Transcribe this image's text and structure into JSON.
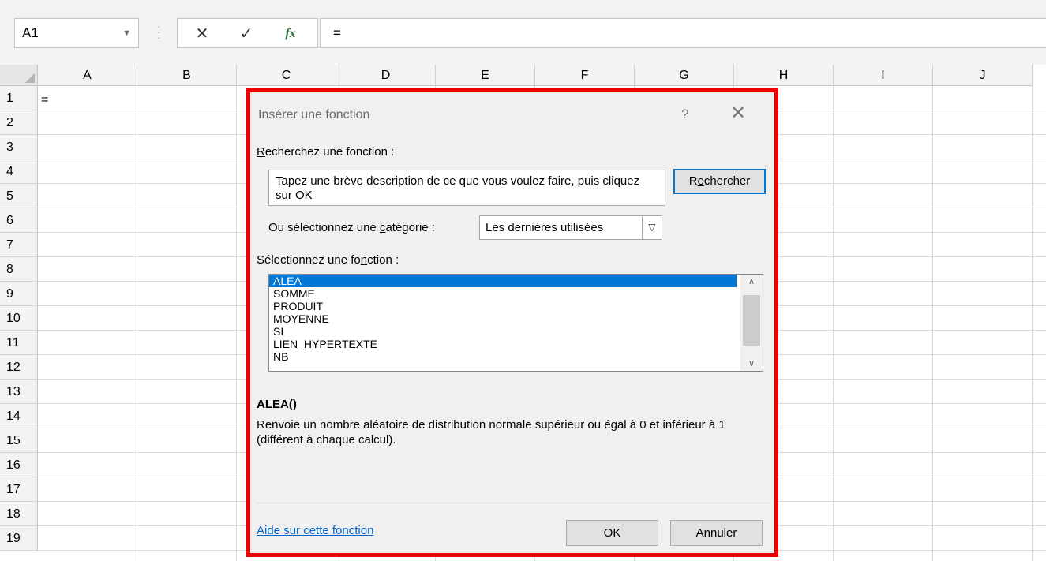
{
  "formula_bar": {
    "name_box": "A1",
    "cancel_glyph": "✕",
    "enter_glyph": "✓",
    "fx_label": "fx",
    "formula": "="
  },
  "sheet": {
    "columns": [
      "A",
      "B",
      "C",
      "D",
      "E",
      "F",
      "G",
      "H",
      "I",
      "J"
    ],
    "rows": [
      "1",
      "2",
      "3",
      "4",
      "5",
      "6",
      "7",
      "8",
      "9",
      "10",
      "11",
      "12",
      "13",
      "14",
      "15",
      "16",
      "17",
      "18",
      "19"
    ],
    "cell_a1": "="
  },
  "dialog": {
    "title": "Insérer une fonction",
    "help_glyph": "?",
    "close_glyph": "✕",
    "search_label_first": "R",
    "search_label_rest": "echerchez une fonction :",
    "search_text": "Tapez une brève description de ce que vous voulez faire, puis cliquez sur OK",
    "search_button_pre": "R",
    "search_button_u": "e",
    "search_button_post": "chercher",
    "category_label_pre": "Ou sélectionnez une ",
    "category_label_u": "c",
    "category_label_post": "atégorie :",
    "category_value": "Les dernières utilisées",
    "function_label_pre": "Sélectionnez une fo",
    "function_label_u": "n",
    "function_label_post": "ction :",
    "functions": [
      "ALEA",
      "SOMME",
      "PRODUIT",
      "MOYENNE",
      "SI",
      "LIEN_HYPERTEXTE",
      "NB"
    ],
    "selected_function": "ALEA",
    "description_title": "ALEA()",
    "description": "Renvoie un nombre aléatoire de distribution normale supérieur ou égal à 0 et inférieur à 1 (différent à chaque calcul).",
    "help_link": "Aide sur cette fonction",
    "ok_label": "OK",
    "cancel_label": "Annuler"
  },
  "colors": {
    "highlight_frame": "#ee0000",
    "selection": "#0078d7",
    "link": "#0066cc"
  }
}
